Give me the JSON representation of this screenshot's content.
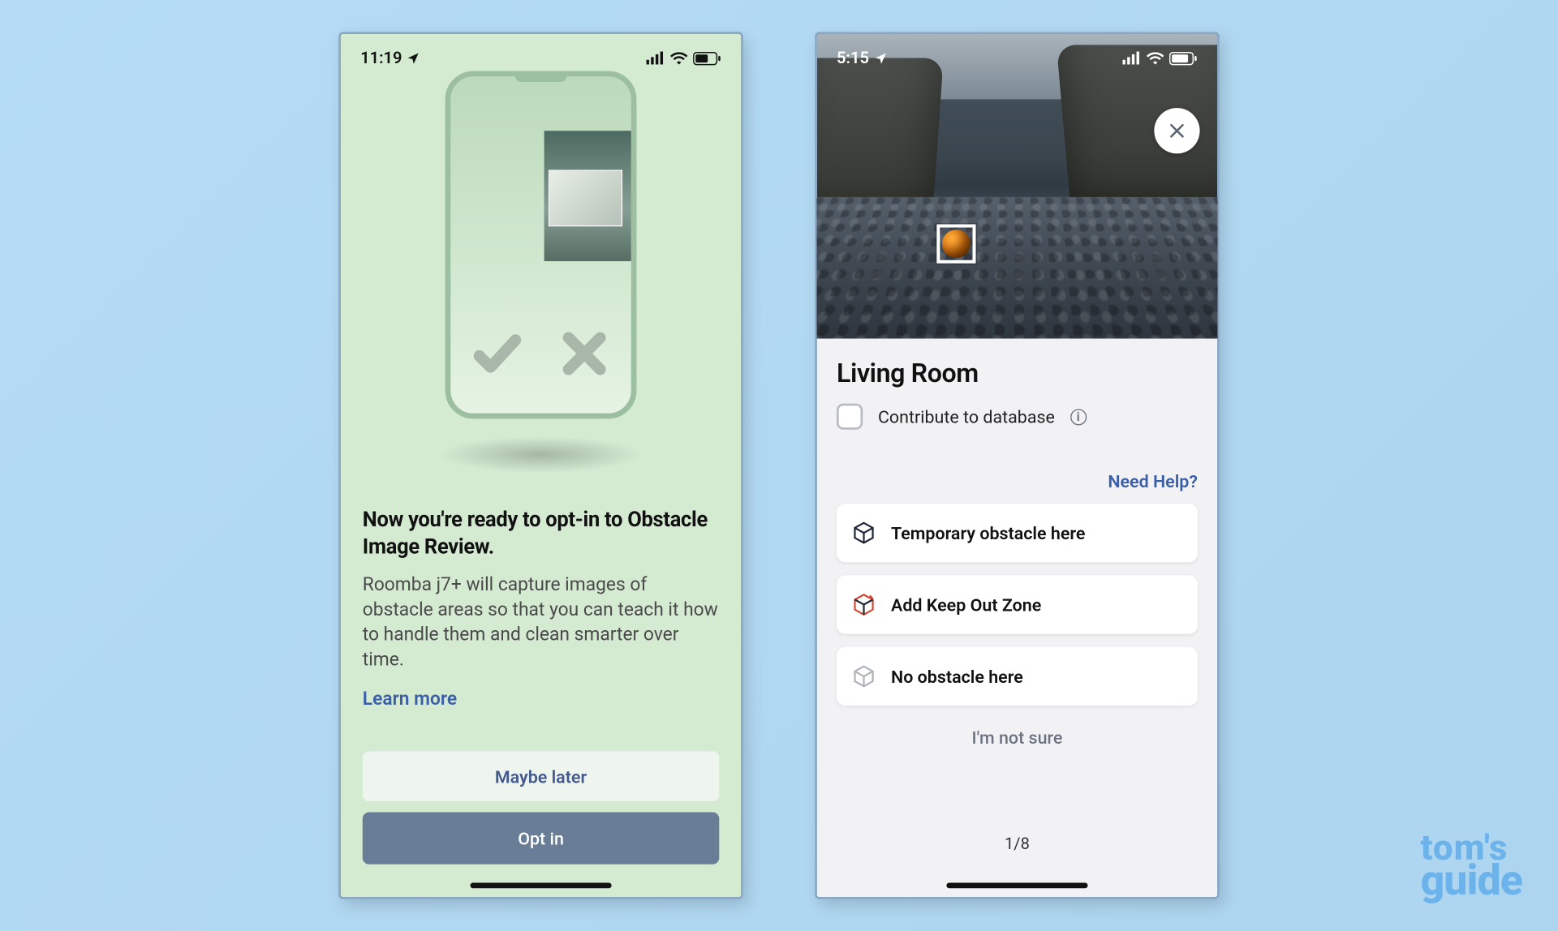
{
  "leftPhone": {
    "status": {
      "time": "11:19"
    },
    "headline": "Now you're ready to opt-in to Obstacle Image Review.",
    "description": "Roomba j7+ will capture images of obstacle areas so that you can teach it how to handle them and clean smarter over time.",
    "learnMore": "Learn more",
    "maybeLater": "Maybe later",
    "optIn": "Opt in"
  },
  "rightPhone": {
    "status": {
      "time": "5:15"
    },
    "roomName": "Living Room",
    "contribute": "Contribute to database",
    "needHelp": "Need Help?",
    "options": {
      "temporary": "Temporary obstacle here",
      "keepOut": "Add Keep Out Zone",
      "none": "No obstacle here"
    },
    "notSure": "I'm not sure",
    "pager": "1/8"
  },
  "watermark": {
    "line1": "tom's",
    "line2": "guide"
  }
}
